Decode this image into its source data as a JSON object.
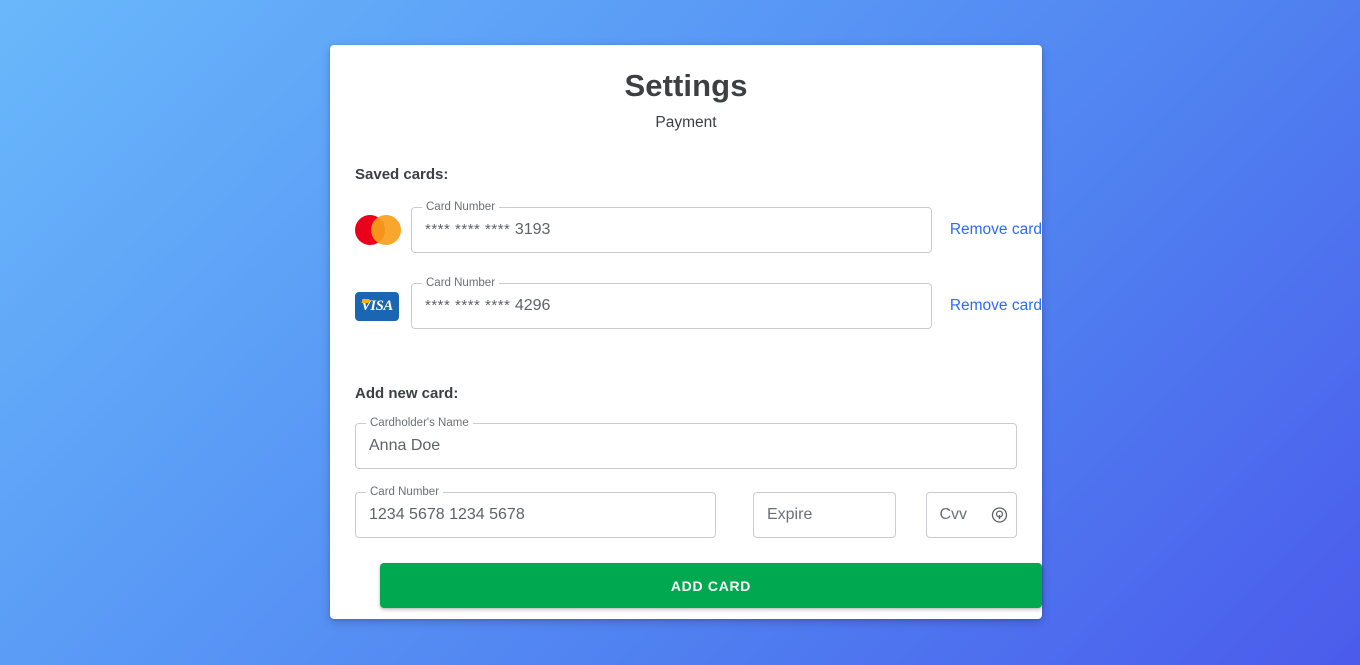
{
  "header": {
    "title": "Settings",
    "subtitle": "Payment"
  },
  "saved_cards_section": {
    "label": "Saved cards:",
    "cards": [
      {
        "brand": "mastercard",
        "field_legend": "Card Number",
        "masked_digits": "**** **** ****",
        "last4": "3193",
        "remove_label": "Remove card"
      },
      {
        "brand": "visa",
        "brand_text": "VISA",
        "field_legend": "Card Number",
        "masked_digits": "**** **** ****",
        "last4": "4296",
        "remove_label": "Remove card"
      }
    ]
  },
  "add_new_card_section": {
    "label": "Add new card:",
    "cardholder_name": {
      "legend": "Cardholder's Name",
      "value": "Anna Doe"
    },
    "card_number": {
      "legend": "Card Number",
      "value": "1234 5678 1234 5678"
    },
    "expire": {
      "placeholder": "Expire",
      "value": ""
    },
    "cvv": {
      "placeholder": "Cvv",
      "value": "",
      "icon": "cvv-help-icon"
    },
    "submit_label": "ADD CARD"
  },
  "colors": {
    "background_start": "#6ab8fb",
    "background_end": "#4b5bec",
    "panel": "#ffffff",
    "link": "#2b6cf6",
    "submit_button": "#00a94f",
    "text_primary": "#3c4043",
    "text_secondary": "#5f6368",
    "mastercard_red": "#eb001b",
    "mastercard_orange": "#f79e1b",
    "visa_blue": "#1a66b3",
    "visa_gold": "#f7b600"
  }
}
